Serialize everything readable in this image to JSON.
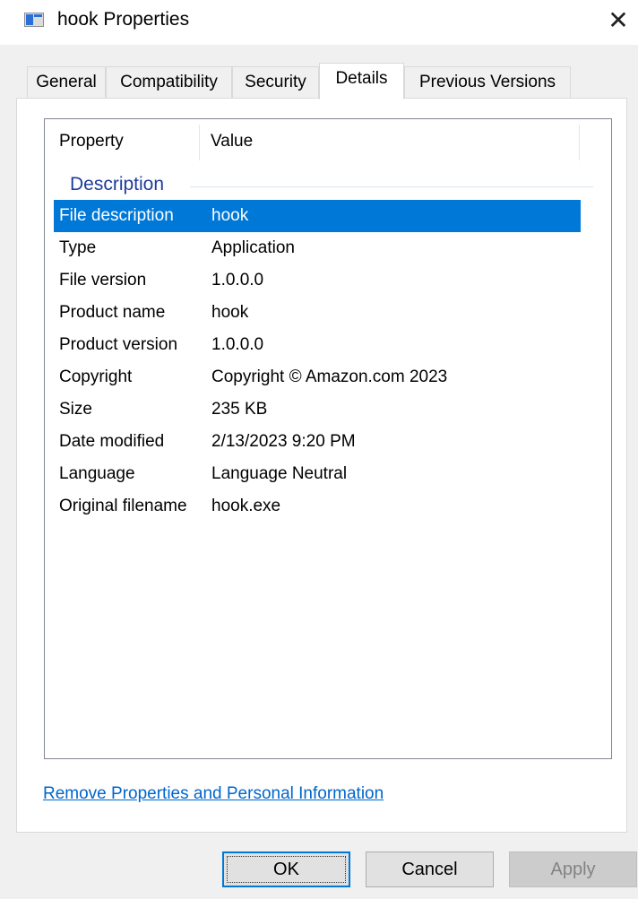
{
  "window": {
    "title": "hook Properties",
    "close_glyph": "✕"
  },
  "tabs": [
    {
      "label": "General"
    },
    {
      "label": "Compatibility"
    },
    {
      "label": "Security"
    },
    {
      "label": "Details",
      "active": true
    },
    {
      "label": "Previous Versions"
    }
  ],
  "details": {
    "columns": {
      "property": "Property",
      "value": "Value"
    },
    "group": "Description",
    "rows": [
      {
        "property": "File description",
        "value": "hook",
        "selected": true
      },
      {
        "property": "Type",
        "value": "Application"
      },
      {
        "property": "File version",
        "value": "1.0.0.0"
      },
      {
        "property": "Product name",
        "value": "hook"
      },
      {
        "property": "Product version",
        "value": "1.0.0.0"
      },
      {
        "property": "Copyright",
        "value": "Copyright © Amazon.com 2023"
      },
      {
        "property": "Size",
        "value": "235 KB"
      },
      {
        "property": "Date modified",
        "value": "2/13/2023 9:20 PM"
      },
      {
        "property": "Language",
        "value": "Language Neutral"
      },
      {
        "property": "Original filename",
        "value": "hook.exe"
      }
    ]
  },
  "link": {
    "label": "Remove Properties and Personal Information"
  },
  "buttons": {
    "ok": "OK",
    "cancel": "Cancel",
    "apply": "Apply"
  },
  "colors": {
    "selection": "#0078d7",
    "group_header": "#1e3d9c",
    "link": "#0066cc"
  }
}
